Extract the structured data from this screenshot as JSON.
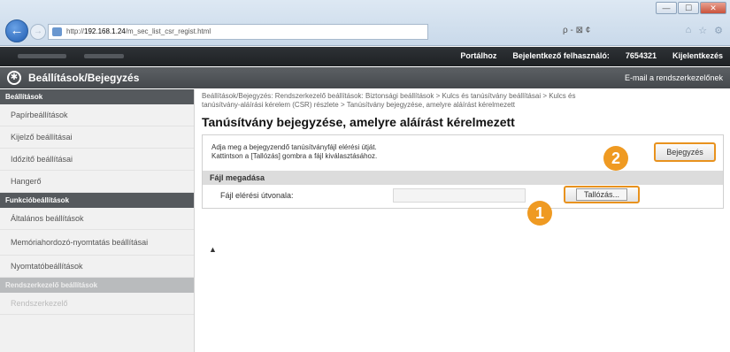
{
  "window": {
    "minimize": "—",
    "maximize": "☐",
    "close": "✕"
  },
  "browser": {
    "url_prefix": "http://",
    "url_host": "192.168.1.24",
    "url_path": "/m_sec_list_csr_regist.html",
    "search_glyph": "ρ - ⊠ ¢",
    "toolbar_icons": [
      "home-icon",
      "star-icon",
      "gear-icon"
    ]
  },
  "topband": {
    "links": [
      "Portálhoz",
      "Bejelentkező felhasználó:",
      "7654321",
      "Kijelentkezés"
    ]
  },
  "titleband": {
    "title": "Beállítások/Bejegyzés",
    "email": "E-mail a rendszerkezelőnek"
  },
  "sidebar": {
    "sections": [
      {
        "heading": "Beállítások",
        "items": [
          "Papírbeállítások",
          "Kijelző beállításai",
          "Időzítő beállításai",
          "Hangerő"
        ]
      },
      {
        "heading": "Funkcióbeállítások",
        "items": [
          "Általános beállítások",
          "Memóriahordozó-nyomtatás beállításai",
          "Nyomtatóbeállítások"
        ]
      },
      {
        "heading": "Rendszerkezelő beállítások",
        "items": [
          "Rendszerkezelő"
        ]
      }
    ]
  },
  "main": {
    "breadcrumb_line1": "Beállítások/Bejegyzés: Rendszerkezelő beállítások: Biztonsági beállítások > Kulcs és tanúsítvány beállításai > Kulcs és",
    "breadcrumb_line2": "tanúsítvány-aláírási kérelem (CSR) részlete > Tanúsítvány bejegyzése, amelyre aláírást kérelmezett",
    "page_title": "Tanúsítvány bejegyzése, amelyre aláírást kérelmezett",
    "instruction_line1": "Adja meg a bejegyzendő tanúsítványfájl elérési útját.",
    "instruction_line2": "Kattintson a [Tallózás] gombra a fájl kiválasztásához.",
    "register_button": "Bejegyzés",
    "section_heading": "Fájl megadása",
    "field_label": "Fájl elérési útvonala:",
    "field_value": "",
    "browse_button": "Tallózás...",
    "top_link": "▲",
    "badges": [
      "1",
      "2"
    ]
  },
  "colors": {
    "accent": "#ef9a22",
    "dark_band": "#45494d",
    "sidebar_bg": "#f1f1f1"
  }
}
